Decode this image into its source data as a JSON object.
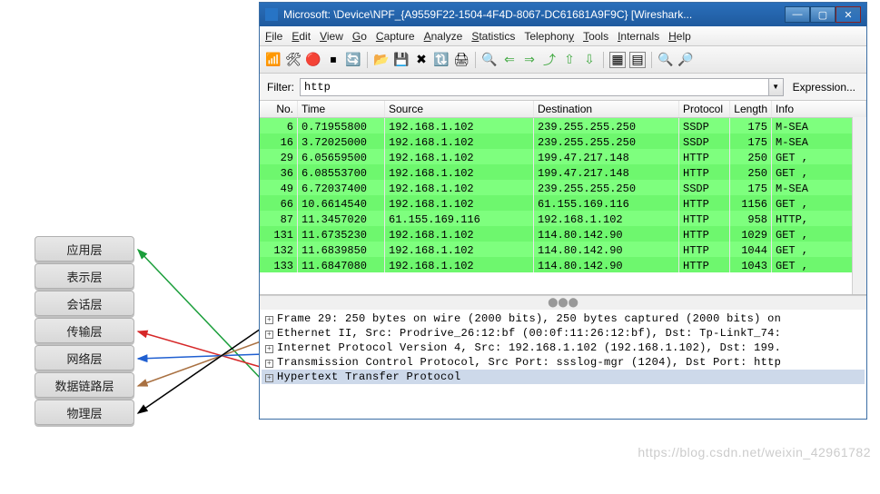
{
  "osi_layers": [
    "应用层",
    "表示层",
    "会话层",
    "传输层",
    "网络层",
    "数据链路层",
    "物理层"
  ],
  "title": "Microsoft: \\Device\\NPF_{A9559F22-1504-4F4D-8067-DC61681A9F9C}   [Wireshark...",
  "menu": [
    "File",
    "Edit",
    "View",
    "Go",
    "Capture",
    "Analyze",
    "Statistics",
    "Telephony",
    "Tools",
    "Internals",
    "Help"
  ],
  "filter": {
    "label": "Filter:",
    "value": "http",
    "expression": "Expression..."
  },
  "columns": {
    "no": "No.",
    "time": "Time",
    "src": "Source",
    "dst": "Destination",
    "proto": "Protocol",
    "len": "Length",
    "info": "Info"
  },
  "packets": [
    {
      "no": "6",
      "time": "0.71955800",
      "src": "192.168.1.102",
      "dst": "239.255.255.250",
      "proto": "SSDP",
      "len": "175",
      "info": "M-SEA"
    },
    {
      "no": "16",
      "time": "3.72025000",
      "src": "192.168.1.102",
      "dst": "239.255.255.250",
      "proto": "SSDP",
      "len": "175",
      "info": "M-SEA"
    },
    {
      "no": "29",
      "time": "6.05659500",
      "src": "192.168.1.102",
      "dst": "199.47.217.148",
      "proto": "HTTP",
      "len": "250",
      "info": "GET ,"
    },
    {
      "no": "36",
      "time": "6.08553700",
      "src": "192.168.1.102",
      "dst": "199.47.217.148",
      "proto": "HTTP",
      "len": "250",
      "info": "GET ,"
    },
    {
      "no": "49",
      "time": "6.72037400",
      "src": "192.168.1.102",
      "dst": "239.255.255.250",
      "proto": "SSDP",
      "len": "175",
      "info": "M-SEA"
    },
    {
      "no": "66",
      "time": "10.6614540",
      "src": "192.168.1.102",
      "dst": "61.155.169.116",
      "proto": "HTTP",
      "len": "1156",
      "info": "GET ,"
    },
    {
      "no": "87",
      "time": "11.3457020",
      "src": "61.155.169.116",
      "dst": "192.168.1.102",
      "proto": "HTTP",
      "len": "958",
      "info": "HTTP,"
    },
    {
      "no": "131",
      "time": "11.6735230",
      "src": "192.168.1.102",
      "dst": "114.80.142.90",
      "proto": "HTTP",
      "len": "1029",
      "info": "GET ,"
    },
    {
      "no": "132",
      "time": "11.6839850",
      "src": "192.168.1.102",
      "dst": "114.80.142.90",
      "proto": "HTTP",
      "len": "1044",
      "info": "GET ,"
    },
    {
      "no": "133",
      "time": "11.6847080",
      "src": "192.168.1.102",
      "dst": "114.80.142.90",
      "proto": "HTTP",
      "len": "1043",
      "info": "GET ,"
    }
  ],
  "details": [
    "Frame 29: 250 bytes on wire (2000 bits), 250 bytes captured (2000 bits) on",
    "Ethernet II, Src: Prodrive_26:12:bf (00:0f:11:26:12:bf), Dst: Tp-LinkT_74:",
    "Internet Protocol Version 4, Src: 192.168.1.102 (192.168.1.102), Dst: 199.",
    "Transmission Control Protocol, Src Port: ssslog-mgr (1204), Dst Port: http",
    "Hypertext Transfer Protocol"
  ],
  "watermark": "https://blog.csdn.net/weixin_42961782"
}
